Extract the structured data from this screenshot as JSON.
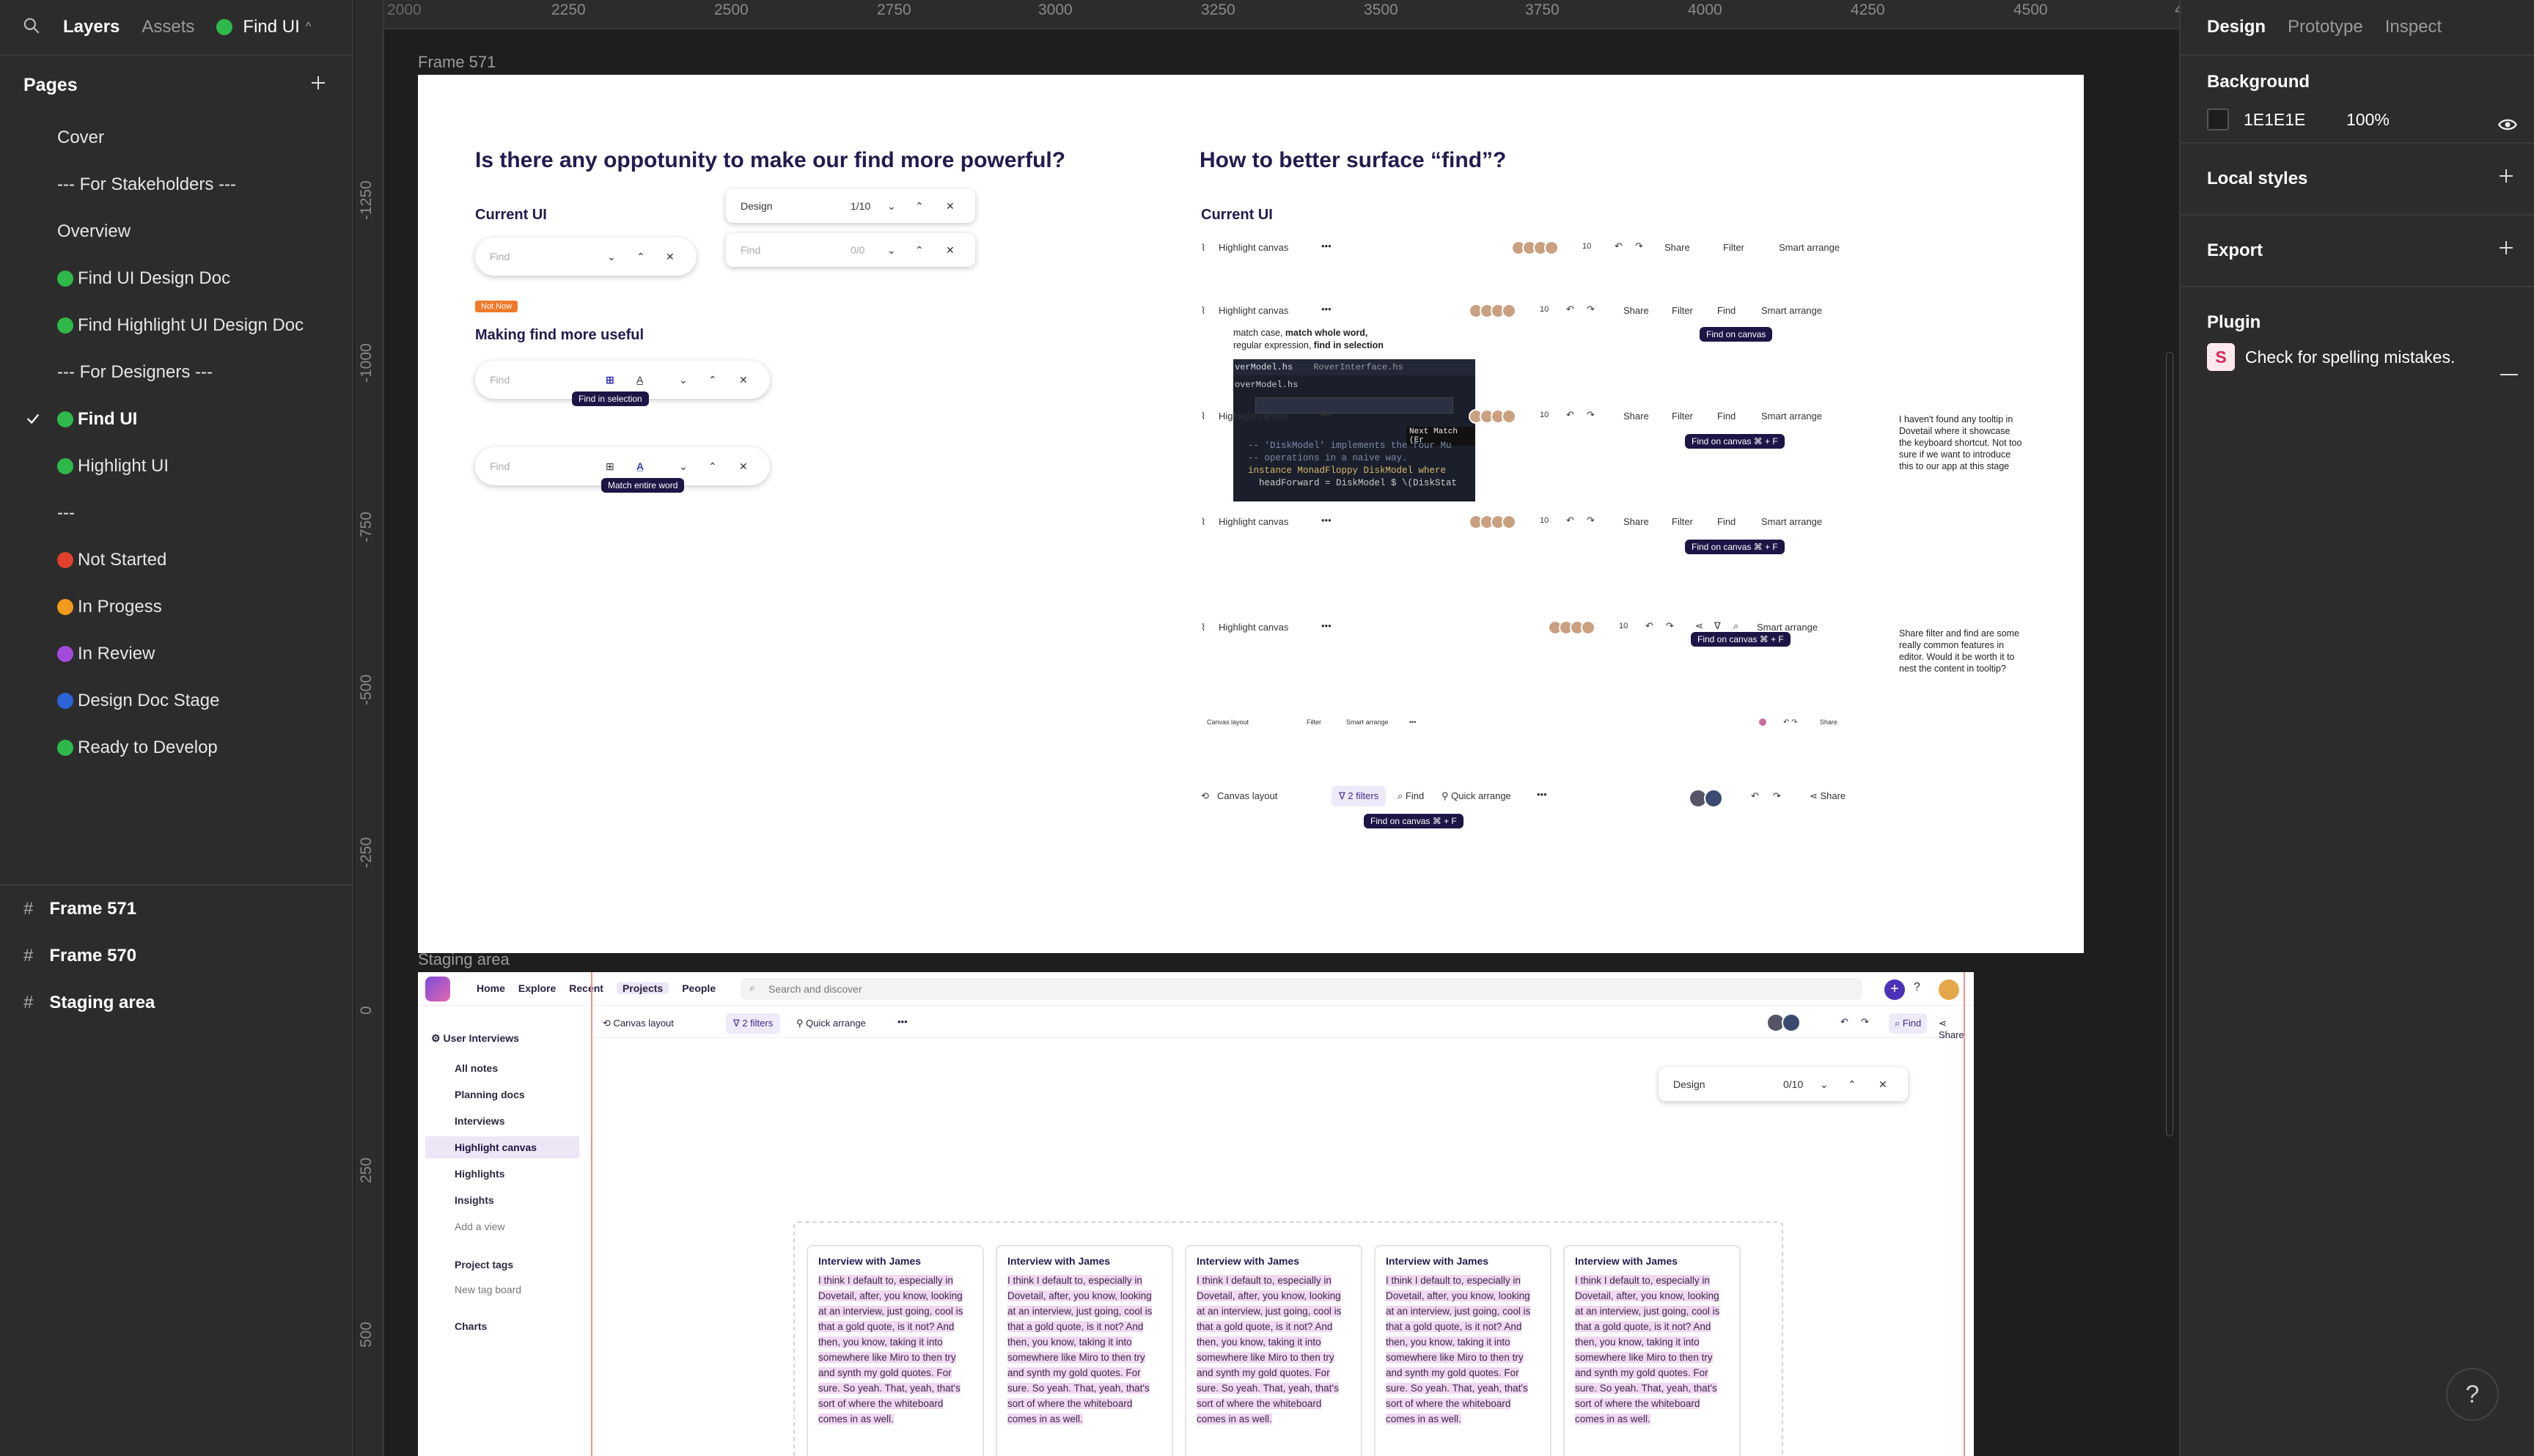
{
  "left_panel": {
    "tabs": {
      "layers": "Layers",
      "assets": "Assets"
    },
    "file_name": "Find UI",
    "pages_heading": "Pages",
    "pages": [
      {
        "label": "Cover",
        "dot": "none"
      },
      {
        "label": "--- For Stakeholders ---",
        "dot": "none"
      },
      {
        "label": "Overview",
        "dot": "none"
      },
      {
        "label": "Find UI Design Doc",
        "dot": "g"
      },
      {
        "label": "Find Highlight UI Design Doc",
        "dot": "g"
      },
      {
        "label": "--- For Designers ---",
        "dot": "none"
      },
      {
        "label": "Find UI",
        "dot": "g",
        "current": true
      },
      {
        "label": "Highlight UI",
        "dot": "g"
      },
      {
        "label": "---",
        "dot": "none"
      },
      {
        "label": "Not Started",
        "dot": "r"
      },
      {
        "label": "In Progess",
        "dot": "o"
      },
      {
        "label": "In Review",
        "dot": "p"
      },
      {
        "label": "Design Doc Stage",
        "dot": "b"
      },
      {
        "label": "Ready to Develop",
        "dot": "g"
      }
    ],
    "frames": [
      "Frame 571",
      "Frame 570",
      "Staging area"
    ]
  },
  "canvas": {
    "ruler_x": [
      "2000",
      "2250",
      "2500",
      "2750",
      "3000",
      "3250",
      "3500",
      "3750",
      "4000",
      "4250",
      "4500",
      "4"
    ],
    "ruler_y": [
      "-1250",
      "-1000",
      "-750",
      "-500",
      "-250",
      "0",
      "250",
      "500"
    ],
    "frame571_label": "Frame 571",
    "staging_label": "Staging area",
    "frame571": {
      "left_title": "Is there any oppotunity to make our find more powerful?",
      "current_ui": "Current UI",
      "find_placeholder": "Find",
      "design_value": "Design",
      "count_1": "1/10",
      "count_2": "0/0",
      "not_now": "Not Now",
      "making_find": "Making find more useful",
      "tip_find_in_selection": "Find in selection",
      "tip_match_entire_word": "Match entire word",
      "match_desc": {
        "a": "match case, ",
        "b": "match whole word,",
        "c": "regular expression, ",
        "d": "find in selection"
      },
      "code": {
        "tab1": "verModel.hs",
        "tab2": "RoverInterface.hs",
        "file": "overModel.hs",
        "next_match": "Next Match (Er",
        "line1": "-- 'DiskModel' implements the four Mu",
        "line2": "-- operations in a naive way.",
        "line3": "instance MonadFloppy DiskModel where",
        "line4": "  headForward = DiskModel $ \\(DiskStat"
      },
      "right_title": "How to better surface “find”?",
      "current_ui_right": "Current UI",
      "toolbar": {
        "highlight": "Highlight canvas",
        "share": "Share",
        "filter": "Filter",
        "find": "Find",
        "smart": "Smart arrange",
        "count": "10",
        "find_on_canvas": "Find on canvas",
        "shortcut": "⌘ + F"
      },
      "note1": "I haven't found any tooltip in Dovetail where it showcase the keyboard shortcut. Not too sure if we want to introduce this to our app at this stage",
      "note2": "Share filter and find are some really common features in editor. Would it be worth it to nest the content in tooltip?",
      "mini": {
        "canvas_layout": "Canvas layout",
        "filter": "Filter",
        "smart": "Smart arrange",
        "share": "Share"
      },
      "last_row": {
        "canvas_layout": "Canvas layout",
        "filters": "2 filters",
        "find": "Find",
        "quick": "Quick arrange",
        "share": "Share"
      }
    },
    "staging": {
      "nav": [
        "Home",
        "Explore",
        "Recent",
        "Projects",
        "People"
      ],
      "search_placeholder": "Search and discover",
      "project": "User Interviews",
      "sidebar": [
        "All notes",
        "Planning docs",
        "Interviews",
        "Highlight canvas",
        "Highlights",
        "Insights",
        "Add a view"
      ],
      "sidebar2": [
        "Project tags",
        "New tag board"
      ],
      "sidebar3": [
        "Charts"
      ],
      "toolbar": {
        "canvas_layout": "Canvas layout",
        "filters": "2 filters",
        "quick": "Quick arrange",
        "find": "Find",
        "share": "Share"
      },
      "find_value": "Design",
      "find_count": "0/10",
      "card_title": "Interview with James",
      "card_text": "I think I default to, especially in Dovetail, after, you know, looking at an interview, just going, cool is that a gold quote, is it not? And then, you know, taking it into somewhere like Miro to then try and synth my gold quotes. For sure. So yeah. That, yeah, that's sort of where the whiteboard comes in as well."
    }
  },
  "right_panel": {
    "tabs": [
      "Design",
      "Prototype",
      "Inspect"
    ],
    "background_heading": "Background",
    "bg_hex": "1E1E1E",
    "bg_opacity": "100%",
    "local_styles": "Local styles",
    "export": "Export",
    "plugin": "Plugin",
    "plugin_item": "Check for spelling mistakes.",
    "plugin_letter": "S"
  },
  "colors": {
    "canvas": "#1e1e1e",
    "panel": "#2c2c2c",
    "accent_purple": "#6d3bd8",
    "tooltip": "#1d1546",
    "highlight": "#f1d8f1"
  },
  "help": "?"
}
